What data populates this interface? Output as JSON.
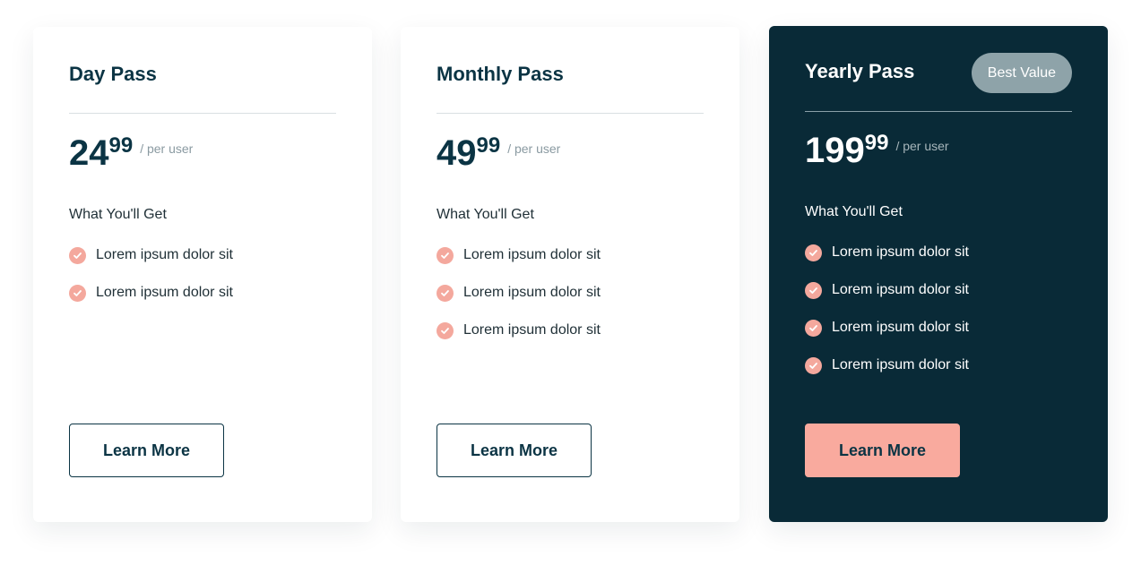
{
  "plans": [
    {
      "name": "Day Pass",
      "price_main": "24",
      "price_cents": "99",
      "price_unit": "/ per user",
      "features_heading": "What You'll Get",
      "features": [
        "Lorem ipsum dolor sit",
        "Lorem ipsum dolor sit"
      ],
      "button_label": "Learn More"
    },
    {
      "name": "Monthly Pass",
      "price_main": "49",
      "price_cents": "99",
      "price_unit": "/ per user",
      "features_heading": "What You'll Get",
      "features": [
        "Lorem ipsum dolor sit",
        "Lorem ipsum dolor sit",
        "Lorem ipsum dolor sit"
      ],
      "button_label": "Learn More"
    },
    {
      "name": "Yearly Pass",
      "badge": "Best Value",
      "price_main": "199",
      "price_cents": "99",
      "price_unit": "/ per user",
      "features_heading": "What You'll Get",
      "features": [
        "Lorem ipsum dolor sit",
        "Lorem ipsum dolor sit",
        "Lorem ipsum dolor sit",
        "Lorem ipsum dolor sit"
      ],
      "button_label": "Learn More"
    }
  ],
  "colors": {
    "dark_card": "#092a37",
    "accent": "#f9aa9e",
    "text_dark": "#0b3444",
    "badge_bg": "#8ea3a9"
  },
  "icons": {
    "feature": "check-circle-icon"
  }
}
